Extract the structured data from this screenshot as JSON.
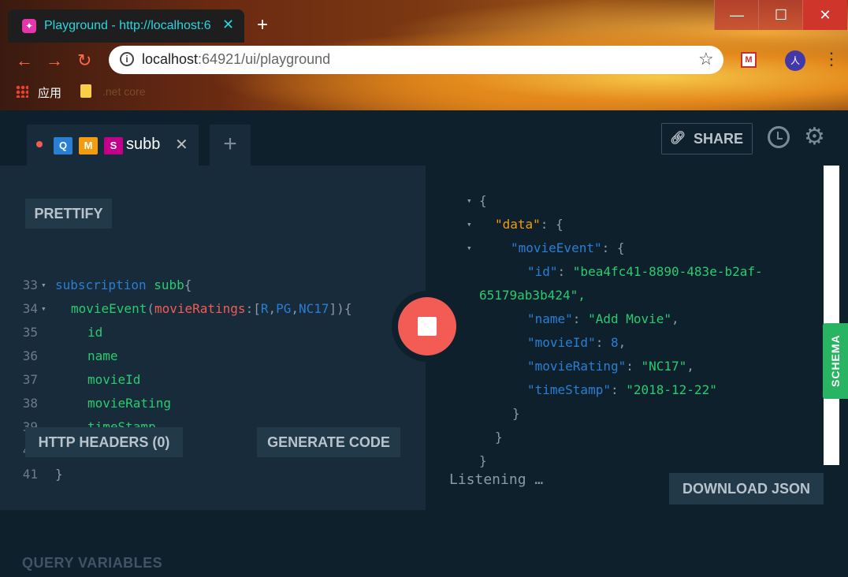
{
  "browser": {
    "tab_title": "Playground - http://localhost:6",
    "tab_close": "✕",
    "new_tab": "+",
    "window_controls": {
      "minimize": "—",
      "maximize": "☐",
      "close": "✕"
    },
    "url_host": "localhost",
    "url_rest": ":64921/ui/playground",
    "bookmarks": [
      {
        "label": "应用"
      },
      {
        "label": ".net core"
      }
    ],
    "avatar_text": "人",
    "extension_text": "M"
  },
  "playground": {
    "tab": {
      "badges": [
        "Q",
        "M",
        "S"
      ],
      "name": "subb",
      "close": "✕"
    },
    "add_tab": "+",
    "share_label": "SHARE",
    "prettify_label": "PRETTIFY",
    "http_headers_label": "HTTP HEADERS (0)",
    "generate_code_label": "GENERATE CODE",
    "query_variables_label": "QUERY VARIABLES",
    "download_json_label": "DOWNLOAD JSON",
    "listening_text": "Listening …",
    "schema_label": "SCHEMA",
    "editor_lines": [
      {
        "n": "33",
        "kw": "subscription",
        "name": "subb",
        "rest": "{"
      },
      {
        "n": "34",
        "fn": "movieEvent",
        "arg": "movieRatings",
        "enums": [
          "R",
          "PG",
          "NC17"
        ]
      },
      {
        "n": "35",
        "field": "id"
      },
      {
        "n": "36",
        "field": "name"
      },
      {
        "n": "37",
        "field": "movieId"
      },
      {
        "n": "38",
        "field": "movieRating"
      },
      {
        "n": "39",
        "field": "timeStamp"
      },
      {
        "n": "40",
        "text": "}"
      },
      {
        "n": "41",
        "text": "}"
      }
    ],
    "result": {
      "data_key": "\"data\"",
      "event_key": "\"movieEvent\"",
      "id_key": "\"id\"",
      "id_value_part1": "\"bea4fc41-8890-483e-b2af-",
      "id_value_part2": "65179ab3b424\",",
      "name_key": "\"name\"",
      "name_value": "\"Add Movie\"",
      "movieId_key": "\"movieId\"",
      "movieId_value": "8",
      "movieRating_key": "\"movieRating\"",
      "movieRating_value": "\"NC17\"",
      "timeStamp_key": "\"timeStamp\"",
      "timeStamp_value": "\"2018-12-22\""
    }
  },
  "colors": {
    "accent_red": "#f25c54",
    "query_blue": "#2a7ed3",
    "mutation_orange": "#f39c12",
    "subscription_pink": "#c2008a",
    "schema_green": "#28b463"
  }
}
